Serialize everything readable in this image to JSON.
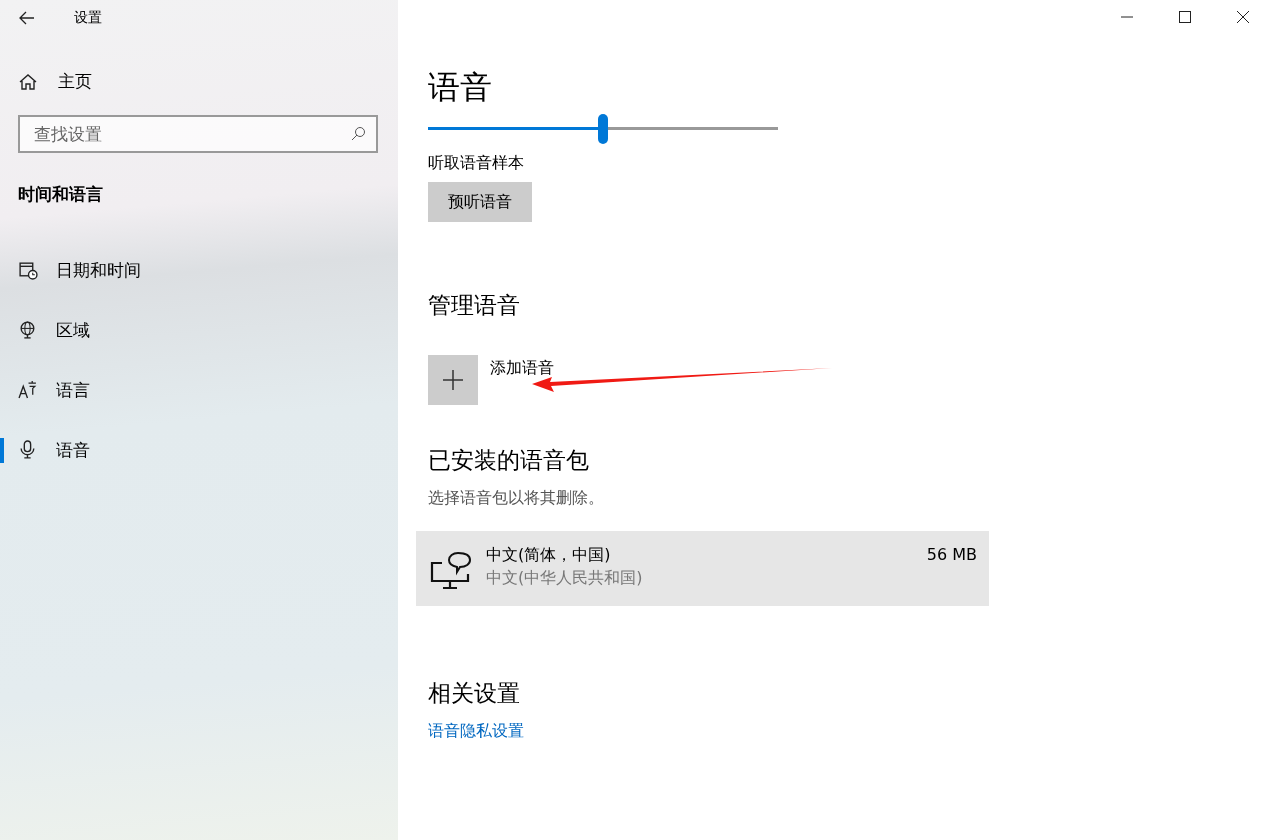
{
  "window": {
    "title": "设置"
  },
  "sidebar": {
    "home": "主页",
    "search": {
      "placeholder": "查找设置"
    },
    "section": "时间和语言",
    "items": [
      {
        "label": "日期和时间",
        "selected": false
      },
      {
        "label": "区域",
        "selected": false
      },
      {
        "label": "语言",
        "selected": false
      },
      {
        "label": "语音",
        "selected": true
      }
    ]
  },
  "page": {
    "title": "语音",
    "speed_slider": {
      "level": 0.5
    },
    "sample_label": "听取语音样本",
    "preview_button": "预听语音",
    "manage_heading": "管理语音",
    "add_button": "添加语音",
    "installed_heading": "已安装的语音包",
    "installed_hint": "选择语音包以将其删除。",
    "packs": [
      {
        "name": "中文(简体，中国)",
        "region": "中文(中华人民共和国)",
        "size": "56 MB"
      }
    ],
    "related_heading": "相关设置",
    "related_links": [
      "语音隐私设置"
    ]
  },
  "annotation": {
    "kind": "arrow"
  }
}
